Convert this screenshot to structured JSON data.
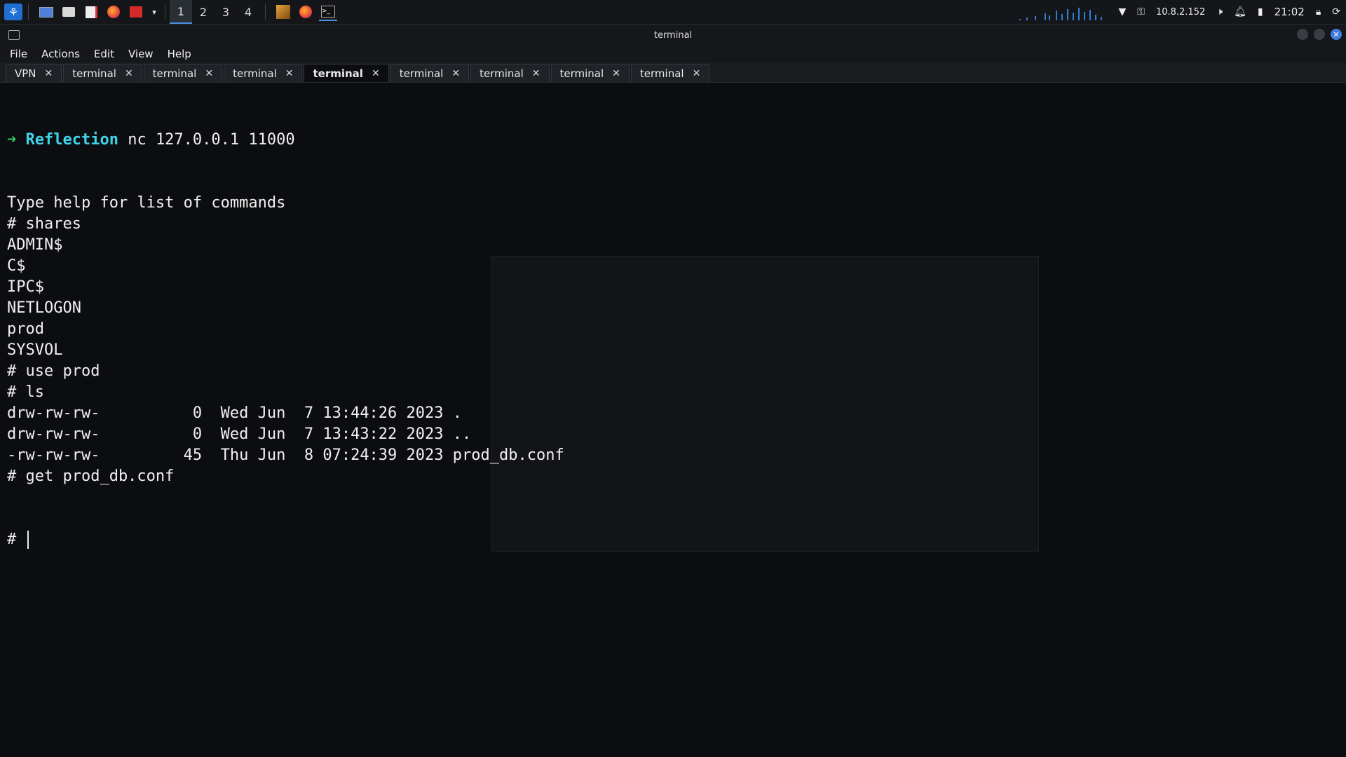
{
  "panel": {
    "workspaces": [
      "1",
      "2",
      "3",
      "4"
    ],
    "active_workspace": "1",
    "ip": "10.8.2.152",
    "clock": "21:02"
  },
  "window": {
    "title": "terminal",
    "menu": [
      "File",
      "Actions",
      "Edit",
      "View",
      "Help"
    ],
    "tabs": [
      {
        "label": "VPN"
      },
      {
        "label": "terminal"
      },
      {
        "label": "terminal"
      },
      {
        "label": "terminal"
      },
      {
        "label": "terminal"
      },
      {
        "label": "terminal"
      },
      {
        "label": "terminal"
      },
      {
        "label": "terminal"
      },
      {
        "label": "terminal"
      }
    ],
    "active_tab_index": 4
  },
  "terminal": {
    "prompt_arrow": "➜",
    "prompt_dir": "Reflection",
    "prompt_cmd": "nc 127.0.0.1 11000",
    "lines": [
      "Type help for list of commands",
      "# shares",
      "ADMIN$",
      "C$",
      "IPC$",
      "NETLOGON",
      "prod",
      "SYSVOL",
      "# use prod",
      "# ls",
      "drw-rw-rw-          0  Wed Jun  7 13:44:26 2023 .",
      "drw-rw-rw-          0  Wed Jun  7 13:43:22 2023 ..",
      "-rw-rw-rw-         45  Thu Jun  8 07:24:39 2023 prod_db.conf",
      "# get prod_db.conf"
    ],
    "current_prompt": "# "
  },
  "icons": [
    "kali-menu-icon",
    "desktop-icon",
    "files-icon",
    "text-editor-icon",
    "firefox-icon",
    "terminal-icon",
    "wifi-icon",
    "vpn-icon",
    "mute-icon",
    "bell-icon",
    "battery-icon",
    "lock-icon",
    "refresh-icon"
  ]
}
